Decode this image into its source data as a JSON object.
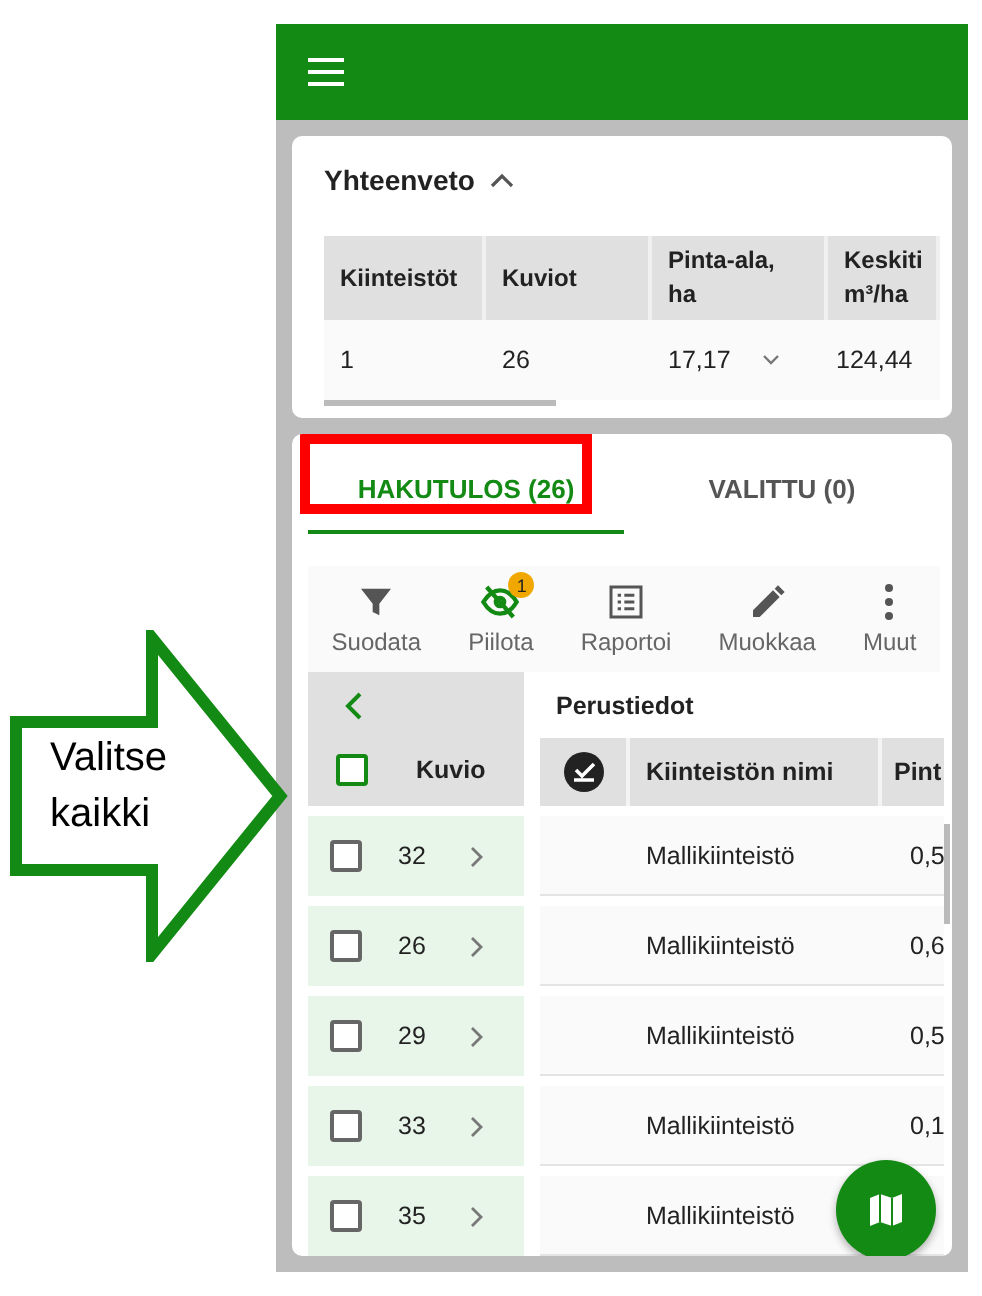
{
  "callout": {
    "text": "Valitse kaikki"
  },
  "summary": {
    "title": "Yhteenveto",
    "expanded": true,
    "columns": [
      "Kiinteistöt",
      "Kuviot",
      "Pinta-ala, ha",
      "Keskiti m³/ha"
    ],
    "rows": [
      {
        "cells": [
          "1",
          "26",
          "17,17",
          "124,44"
        ]
      }
    ]
  },
  "tabs": [
    {
      "label": "HAKUTULOS (26)",
      "selected": true,
      "highlighted": true
    },
    {
      "label": "VALITTU (0)",
      "selected": false,
      "highlighted": false
    }
  ],
  "toolbar": [
    {
      "kind": "filter",
      "label": "Suodata",
      "active": false
    },
    {
      "kind": "hide",
      "label": "Piilota",
      "active": true,
      "badge": "1"
    },
    {
      "kind": "report",
      "label": "Raportoi",
      "active": false
    },
    {
      "kind": "edit",
      "label": "Muokkaa",
      "active": false
    },
    {
      "kind": "more",
      "label": "Muut",
      "active": false
    }
  ],
  "results": {
    "group": "Perustiedot",
    "select_all": {
      "label": "Kuvio",
      "checked": false
    },
    "columns": [
      "Kiinteistön nimi",
      "Pint"
    ],
    "rows": [
      {
        "kuvio": "32",
        "checked": false,
        "name": "Mallikiinteistö",
        "area": "0,5"
      },
      {
        "kuvio": "26",
        "checked": false,
        "name": "Mallikiinteistö",
        "area": "0,6"
      },
      {
        "kuvio": "29",
        "checked": false,
        "name": "Mallikiinteistö",
        "area": "0,5"
      },
      {
        "kuvio": "33",
        "checked": false,
        "name": "Mallikiinteistö",
        "area": "0,1"
      },
      {
        "kuvio": "35",
        "checked": false,
        "name": "Mallikiinteistö"
      }
    ]
  }
}
